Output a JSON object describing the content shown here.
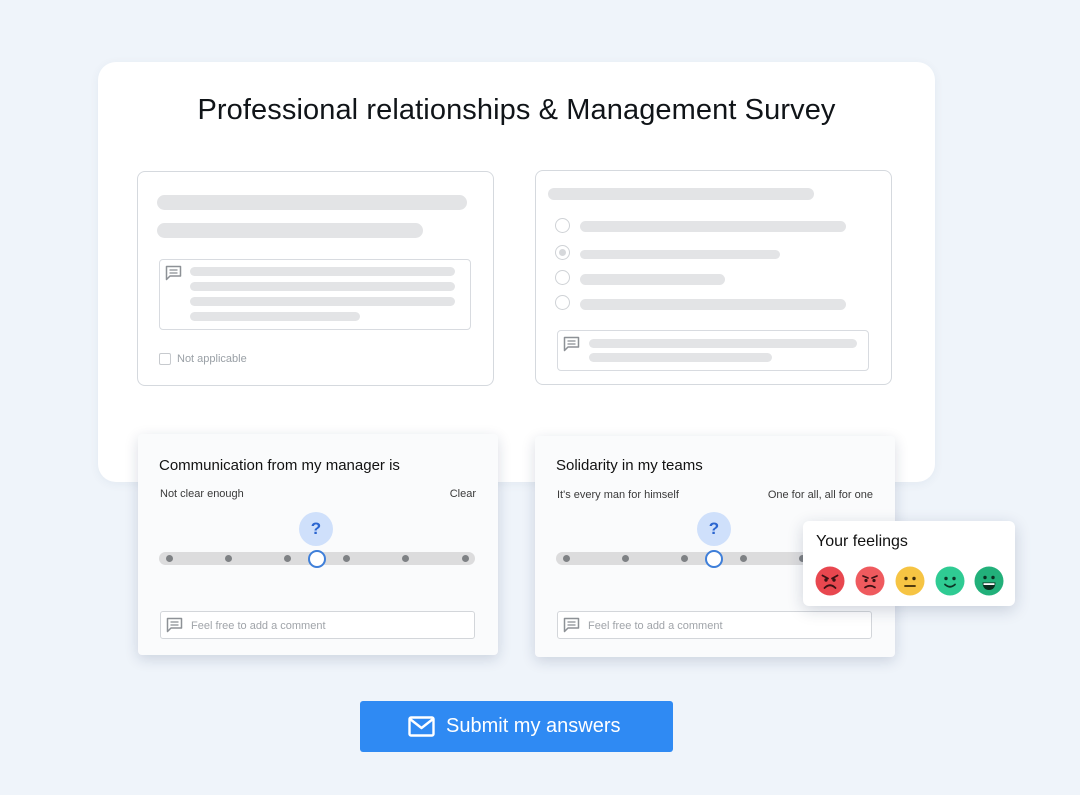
{
  "survey": {
    "title": "Professional relationships & Management Survey",
    "left_panel": {
      "not_applicable_label": "Not applicable"
    }
  },
  "questions": [
    {
      "title": "Communication from my manager is",
      "min_label": "Not clear enough",
      "max_label": "Clear",
      "help_glyph": "?",
      "comment_placeholder": "Feel free to add a comment",
      "scale_steps": 6,
      "selected_position": 0.5
    },
    {
      "title": "Solidarity in my teams",
      "min_label": "It's every man for himself",
      "max_label": "One for all, all for one",
      "help_glyph": "?",
      "comment_placeholder": "Feel free to add a comment",
      "scale_steps": 6,
      "selected_position": 0.5
    }
  ],
  "feelings": {
    "title": "Your feelings",
    "options": [
      "very-angry-face-icon",
      "angry-face-icon",
      "neutral-face-icon",
      "smiling-face-icon",
      "grinning-face-icon"
    ],
    "colors": [
      "#e8474f",
      "#ef5a5e",
      "#f6c443",
      "#2fcb93",
      "#22b07a"
    ]
  },
  "submit": {
    "label": "Submit my answers",
    "icon": "mail-icon",
    "color": "#2f8af3"
  }
}
